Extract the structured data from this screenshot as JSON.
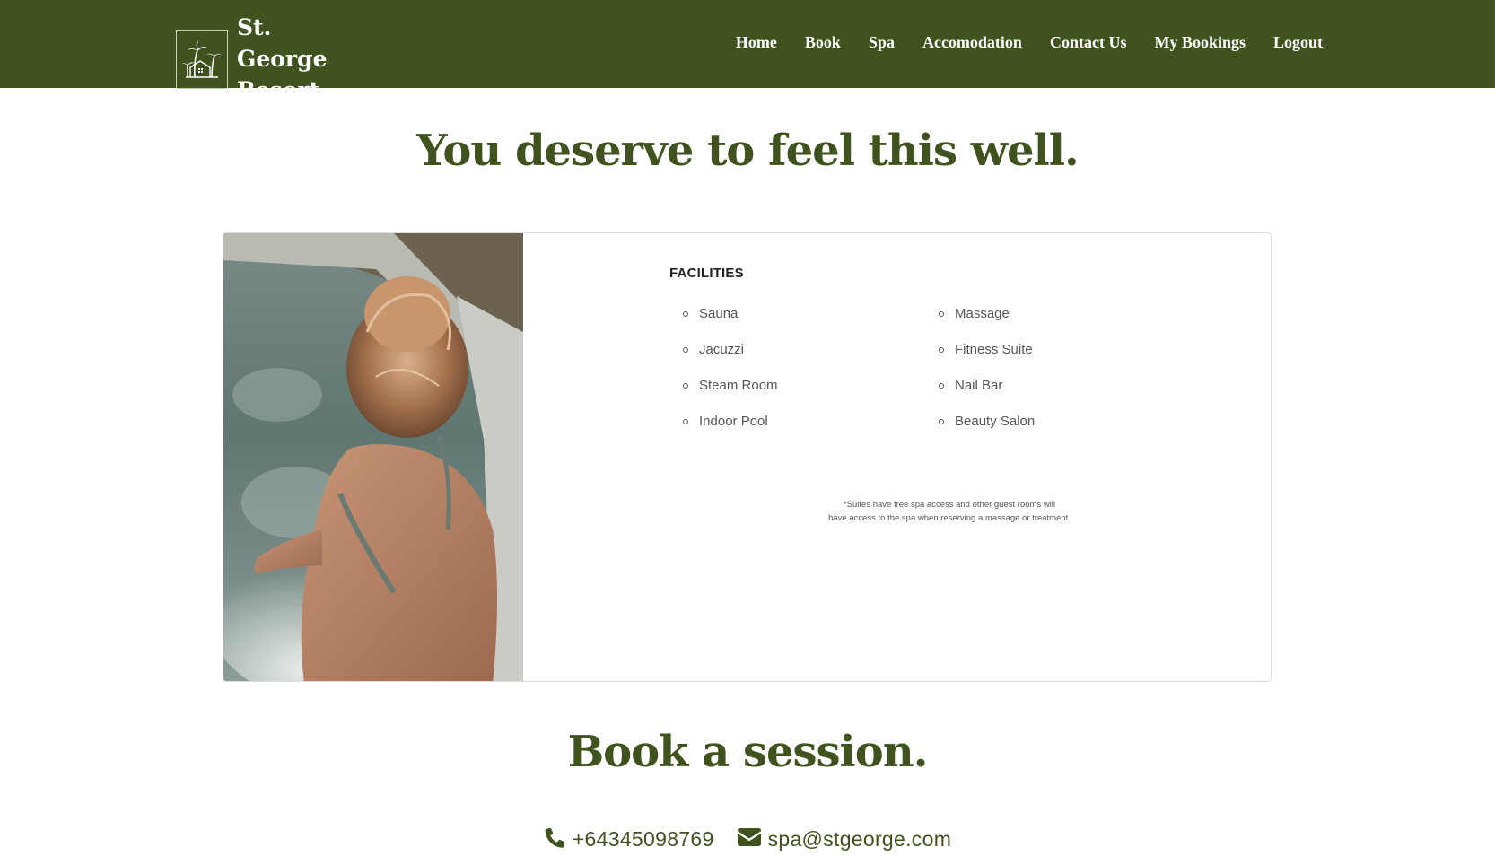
{
  "brand": {
    "line1": "St. George",
    "line2": "Resort",
    "logo_icon": "palm-house-icon"
  },
  "nav": {
    "items": [
      {
        "label": "Home"
      },
      {
        "label": "Book"
      },
      {
        "label": "Spa"
      },
      {
        "label": "Accomodation"
      },
      {
        "label": "Contact Us"
      },
      {
        "label": "My Bookings"
      },
      {
        "label": "Logout"
      }
    ]
  },
  "hero": {
    "title": "You deserve to feel this well."
  },
  "facilities": {
    "heading": "FACILITIES",
    "left": [
      "Sauna",
      "Jacuzzi",
      "Steam Room",
      "Indoor Pool"
    ],
    "right": [
      "Massage",
      "Fitness Suite",
      "Nail Bar",
      "Beauty Salon"
    ],
    "note_line1": "*Suites have free spa access and other guest rooms will",
    "note_line2": "have access to the spa when reserving a massage or treatment."
  },
  "booking": {
    "title": "Book a session.",
    "phone": "+64345098769",
    "phone_icon": "phone-icon",
    "email": "spa@stgeorge.com",
    "email_icon": "envelope-icon"
  },
  "colors": {
    "brand_green": "#40531f",
    "white": "#ffffff"
  }
}
